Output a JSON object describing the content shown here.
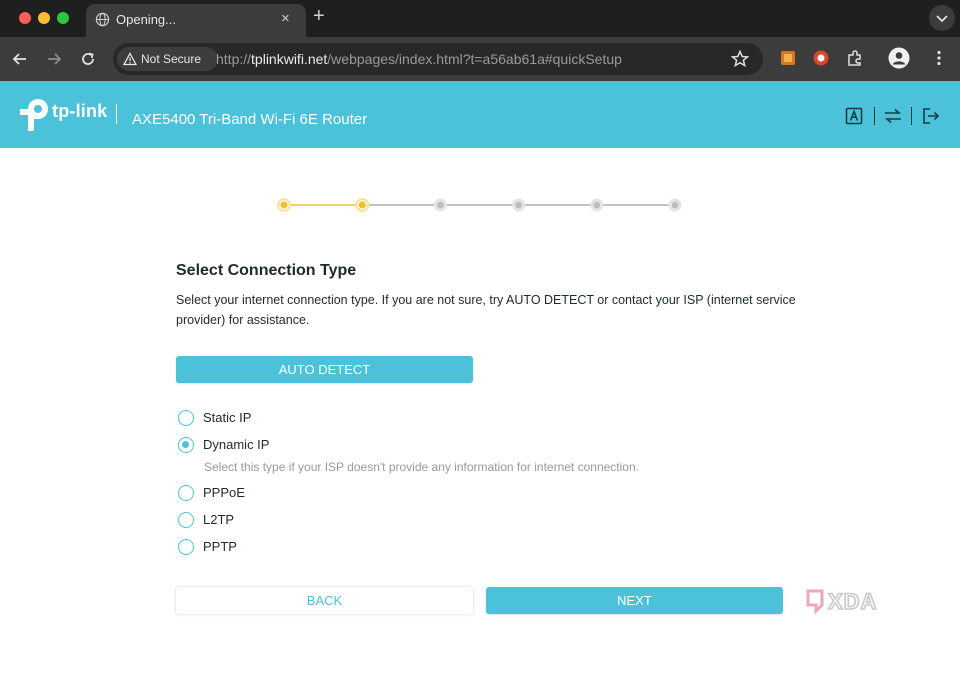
{
  "browser": {
    "tab_title": "Opening...",
    "tab_close": "×",
    "new_tab": "+",
    "security_label": "Not Secure",
    "url_scheme": "http://",
    "url_host": "tplinkwifi.net",
    "url_path": "/webpages/index.html?t=a56ab61a#quickSetup"
  },
  "router": {
    "brand": "tp-link",
    "model": "AXE5400 Tri-Band Wi-Fi 6E Router",
    "header_icons": [
      "language-icon",
      "swap-icon",
      "logout-icon"
    ]
  },
  "wizard": {
    "total_steps": 6,
    "current_step": 2,
    "active_color": "#f2c12e",
    "inactive_color": "#d6d6d6"
  },
  "main": {
    "title": "Select Connection Type",
    "description": "Select your internet connection type. If you are not sure, try AUTO DETECT or contact your ISP (internet service provider) for assistance.",
    "auto_detect_label": "AUTO DETECT",
    "options": [
      {
        "label": "Static IP",
        "checked": false
      },
      {
        "label": "Dynamic IP",
        "checked": true
      },
      {
        "label": "PPPoE",
        "checked": false
      },
      {
        "label": "L2TP",
        "checked": false
      },
      {
        "label": "PPTP",
        "checked": false
      }
    ],
    "dynamic_hint": "Select this type if your ISP doesn't provide any information for internet connection.",
    "back_label": "BACK",
    "next_label": "NEXT"
  },
  "colors": {
    "accent": "#4bc2da",
    "text": "#1e2a2e"
  },
  "watermark": {
    "text": "XDA"
  }
}
